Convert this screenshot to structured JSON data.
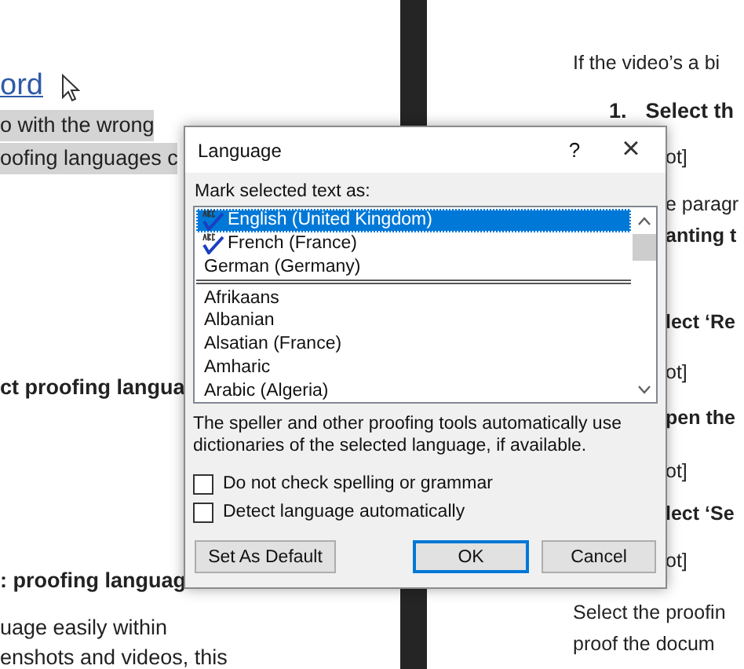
{
  "left_page": {
    "lines": [
      {
        "kind": "link",
        "text": "ord"
      },
      {
        "kind": "highlighted",
        "text": "o with the wrong"
      },
      {
        "kind": "highlighted",
        "text": "oofing languages c"
      },
      {
        "kind": "bold",
        "text": "ct proofing langua"
      },
      {
        "kind": "bold",
        "text": ": proofing languag"
      },
      {
        "kind": "plain",
        "text": "uage easily within"
      },
      {
        "kind": "plain",
        "text": "enshots and videos, this"
      }
    ]
  },
  "right_page": {
    "lines": [
      {
        "kind": "plain",
        "text": "If the video’s a bi"
      },
      {
        "kind": "numbered",
        "number": "1.",
        "text": "Select th"
      },
      {
        "kind": "plain",
        "text": "ot]"
      },
      {
        "kind": "plain",
        "text": "e paragr"
      },
      {
        "kind": "bold",
        "text": "anting t"
      },
      {
        "kind": "bold",
        "text": "lect ‘Re"
      },
      {
        "kind": "plain",
        "text": "ot]"
      },
      {
        "kind": "bold",
        "text": "pen the"
      },
      {
        "kind": "plain",
        "text": "ot]"
      },
      {
        "kind": "bold",
        "text": "lect ‘Se"
      },
      {
        "kind": "plain",
        "text": "ot]"
      },
      {
        "kind": "plain",
        "text": "Select the proofin"
      },
      {
        "kind": "plain",
        "text": "proof the docum"
      }
    ]
  },
  "dialog": {
    "title": "Language",
    "help": "?",
    "close": "×",
    "list_label": "Mark selected text as:",
    "recent_languages": [
      {
        "name": "English (United Kingdom)",
        "proofing": true,
        "selected": true
      },
      {
        "name": "French (France)",
        "proofing": true,
        "selected": false
      },
      {
        "name": "German (Germany)",
        "proofing": false,
        "selected": false
      }
    ],
    "languages": [
      {
        "name": "Afrikaans",
        "selected": false
      },
      {
        "name": "Albanian",
        "selected": false
      },
      {
        "name": "Alsatian (France)",
        "selected": false
      },
      {
        "name": "Amharic",
        "selected": false
      },
      {
        "name": "Arabic (Algeria)",
        "selected": false
      }
    ],
    "description": "The speller and other proofing tools automatically use dictionaries of the selected language, if available.",
    "options": [
      {
        "label": "Do not check spelling or grammar",
        "checked": false
      },
      {
        "label": "Detect language automatically",
        "checked": false
      }
    ],
    "buttons": [
      {
        "label": "Set As Default",
        "default": false
      },
      {
        "label": "OK",
        "default": true
      },
      {
        "label": "Cancel",
        "default": false
      }
    ]
  }
}
